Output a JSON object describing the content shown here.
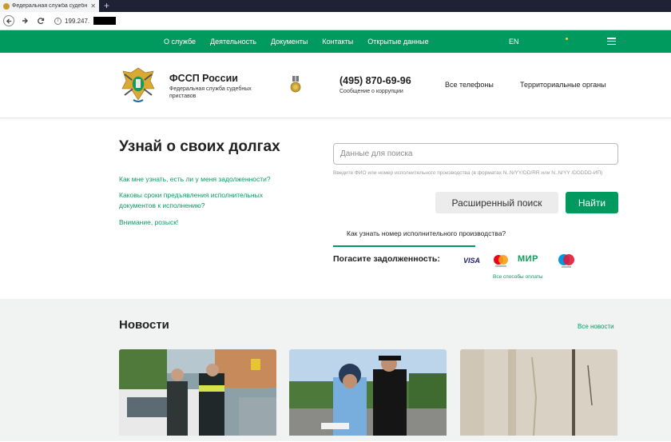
{
  "browser": {
    "tab_title": "Федеральная служба судебн",
    "tab_close": "✕",
    "new_tab": "+",
    "url_prefix": "199.247."
  },
  "nav": {
    "links": [
      "О службе",
      "Деятельность",
      "Документы",
      "Контакты",
      "Открытые данные"
    ],
    "lang": "EN"
  },
  "header": {
    "org_name": "ФССП России",
    "org_subtitle": "Федеральная служба судебных приставов",
    "phone": "(495) 870-69-96",
    "phone_subtitle": "Сообщение о коррупции",
    "all_phones": "Все телефоны",
    "regions": "Территориальные органы"
  },
  "main": {
    "title": "Узнай о своих долгах",
    "faq": [
      "Как мне узнать, есть ли у меня задолженности?",
      "Каковы сроки предъявления исполнительных документов к исполнению?",
      "Внимание, розыск!"
    ],
    "search_placeholder": "Данные для поиска",
    "search_hint": "Введите ФИО или номер исполнительного производства (в форматах N..N/YY/DD/RR или N..N/YY /DDDDD-ИП)",
    "advanced_search": "Расширенный поиск",
    "find": "Найти",
    "how_to": "Как узнать номер исполнительного производства?",
    "pay_label": "Погасите задолженность:",
    "pay_methods": [
      "VISA",
      "МИР"
    ],
    "all_payments": "Все способы оплаты"
  },
  "news": {
    "title": "Новости",
    "all_news": "Все новости"
  },
  "colors": {
    "brand_green": "#009a5e",
    "link_green": "#0a9a62"
  }
}
